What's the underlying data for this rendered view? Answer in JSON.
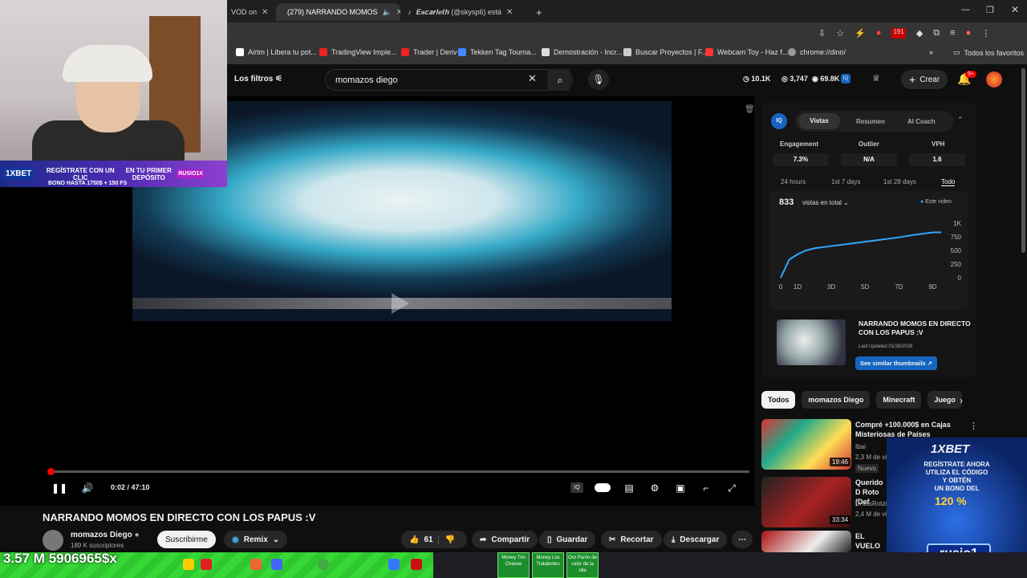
{
  "browser": {
    "tabs": [
      {
        "label": "VOD on",
        "active": false
      },
      {
        "label": "(279) NARRANDO MOMOS",
        "active": true
      },
      {
        "label": "𝑬𝒔𝒄𝒂𝒓𝒍𝒆𝒕𝒉 (@skysp6) está",
        "active": false
      }
    ],
    "new_tab": "+",
    "bookmarks": [
      "Airtm | Libera tu pot...",
      "TradingView Imple...",
      "Trader | Deriv",
      "Tekken Tag Tourna...",
      "Demostración - Incr...",
      "Buscar Proyectos | F...",
      "Webcam Toy - Haz f...",
      "chrome://dino/"
    ],
    "bookmarks_all": "Todos los favoritos",
    "ext_badge": "191"
  },
  "youtube": {
    "filters_label": "Los filtros",
    "search_value": "momazos diego",
    "stats": {
      "a": "10.1K",
      "b": "3,747",
      "c": "69.8K"
    },
    "create_label": "Crear",
    "notif_badge": "9+"
  },
  "webcam_promo": {
    "line1": "REGÍSTRATE CON UN CLIC",
    "line2": "EN TU PRIMER DEPÓSITO",
    "line3": "BONO HASTA 1750$ + 150 FS",
    "tag": "RUSIO1X",
    "brand": "1XBET"
  },
  "player": {
    "time": "0:02 / 47:10"
  },
  "video": {
    "title": "NARRANDO MOMOS EN DIRECTO CON LOS PAPUS :V",
    "channel": "momazos Diego",
    "subscribers": "189 K suscriptores",
    "subscribe_label": "Suscribirme",
    "remix_label": "Remix",
    "likes": "61",
    "share_label": "Compartir",
    "save_label": "Guardar",
    "clip_label": "Recortar",
    "download_label": "Descargar"
  },
  "iq_panel": {
    "logo": "IQ",
    "tabs": [
      "Vistas",
      "Resumen",
      "AI Coach"
    ],
    "metrics": [
      {
        "label": "Engagement",
        "value": "7.3%"
      },
      {
        "label": "Outlier",
        "value": "N/A"
      },
      {
        "label": "VPH",
        "value": "1.6"
      }
    ],
    "ranges": [
      "24 hours",
      "1st 7 days",
      "1st 28 days",
      "Todo"
    ],
    "total_views": "833",
    "views_label": "vistas en total",
    "legend": "Este video",
    "related_title": "NARRANDO MOMOS EN DIRECTO CON LOS PAPUS :V",
    "related_updated": "Last Updated 01/26/2026",
    "similar_btn": "See similar thumbnails ↗"
  },
  "chart_data": {
    "type": "line",
    "x": [
      0,
      0.5,
      1,
      1.5,
      2,
      3,
      4,
      5,
      6,
      7,
      8,
      9,
      9.5
    ],
    "series": [
      {
        "values": [
          0,
          330,
          430,
          500,
          540,
          580,
          620,
          660,
          700,
          740,
          790,
          830,
          833
        ]
      }
    ],
    "xticks": [
      "0",
      "1D",
      "3D",
      "5D",
      "7D",
      "9D"
    ],
    "yticks": [
      "1K",
      "750",
      "500",
      "250",
      "0"
    ],
    "ylim": [
      0,
      1000
    ],
    "color": "#2ea8ff"
  },
  "chips": [
    "Todos",
    "momazos Diego",
    "Minecraft",
    "Juego"
  ],
  "recommendations": [
    {
      "title": "Compré +100.000$ en Cajas Misteriosas de Países",
      "channel": "Ibai",
      "meta": "2,3 M de vi",
      "badge": "Nuevo",
      "duration": "19:46"
    },
    {
      "title": "Querido D Roto (Def",
      "channel": "DrossRotzi",
      "meta": "2,4 M de vi",
      "duration": "33:34"
    },
    {
      "title": "EL VUELO telefónic",
      "channel": "",
      "meta": "",
      "duration": ""
    }
  ],
  "bet_ad": {
    "brand": "1XBET",
    "line1": "REGÍSTRATE AHORA",
    "line2": "UTILIZA EL CÓDIGO",
    "line3": "Y OBTÉN",
    "line4": "UN BONO DEL",
    "percent": "120 %",
    "code": "rusio1"
  },
  "overlay_counter": "3.57 M 5906965$x",
  "tiles": [
    "Money Tim Cheese",
    "Money Los Tralalerites",
    "Oro Punto de calor de la olla"
  ]
}
